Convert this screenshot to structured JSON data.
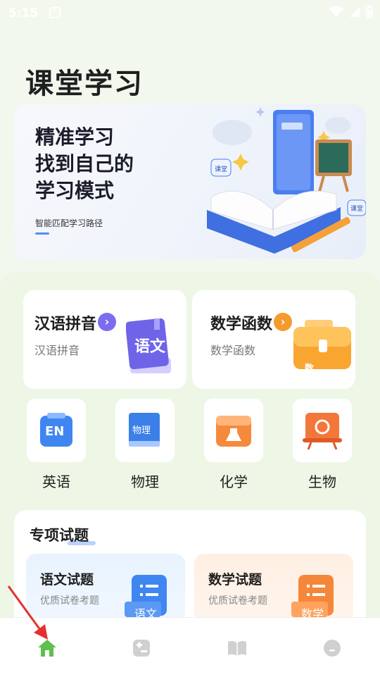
{
  "status_bar": {
    "time": "5:15",
    "notif_icon": "A"
  },
  "page": {
    "title": "课堂学习"
  },
  "banner": {
    "headline": "精准学习\n找到自己的\n学习模式",
    "subtitle": "智能匹配学习路径",
    "book_labels": [
      "课堂",
      "课堂"
    ]
  },
  "subjects": [
    {
      "title": "汉语拼音",
      "subtitle": "汉语拼音",
      "icon_text": "语文",
      "accent": "#7d6cf0"
    },
    {
      "title": "数学函数",
      "subtitle": "数学函数",
      "icon_text": "数",
      "accent": "#f59a2c"
    }
  ],
  "small_subjects": [
    {
      "label": "英语",
      "icon_text": "EN"
    },
    {
      "label": "物理",
      "icon_text": "物理"
    },
    {
      "label": "化学",
      "icon_text": ""
    },
    {
      "label": "生物",
      "icon_text": ""
    }
  ],
  "special": {
    "title": "专项试题",
    "cards": [
      {
        "title": "语文试题",
        "subtitle": "优质试卷考题",
        "icon_text": "语文"
      },
      {
        "title": "数学试题",
        "subtitle": "优质试卷考题",
        "icon_text": "数学"
      }
    ]
  },
  "colors": {
    "nav_active": "#5fbf4f",
    "nav_inactive": "#d0d0d0"
  }
}
